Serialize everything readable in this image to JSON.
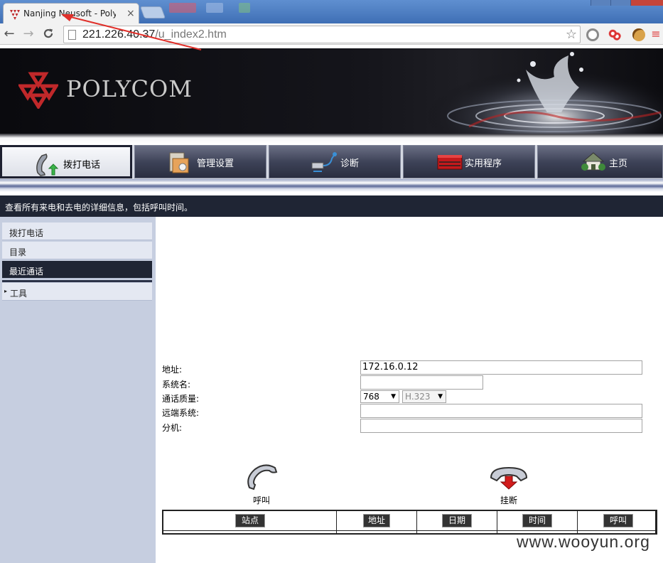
{
  "browser": {
    "tab_title": "Nanjing Neusoft - Polyc",
    "tab_close": "×",
    "url_host": "221.226.40.37",
    "url_path": "/u_index2.htm",
    "back": "←",
    "forward": "→",
    "reload": "C",
    "star": "☆"
  },
  "banner": {
    "logo_text": "POLYCOM"
  },
  "main_nav": [
    {
      "label": "拨打电话",
      "icon": "phone-icon",
      "active": true
    },
    {
      "label": "管理设置",
      "icon": "admin-settings-icon",
      "active": false
    },
    {
      "label": "诊断",
      "icon": "diagnostics-icon",
      "active": false
    },
    {
      "label": "实用程序",
      "icon": "utilities-icon",
      "active": false
    },
    {
      "label": "主页",
      "icon": "home-icon",
      "active": false
    }
  ],
  "description": "查看所有来电和去电的详细信息，包括呼叫时间。",
  "sidebar": {
    "items": [
      {
        "label": "拨打电话"
      },
      {
        "label": "目录"
      },
      {
        "label": "最近通话",
        "active": true
      },
      {
        "label": "工具",
        "arrow": "▸"
      }
    ]
  },
  "form": {
    "address_label": "地址:",
    "address_value": "172.16.0.12",
    "system_name_label": "系统名:",
    "system_name_value": "",
    "quality_label": "通话质量:",
    "quality_rate": "768",
    "quality_protocol": "H.323",
    "remote_system_label": "远端系统:",
    "remote_system_value": "",
    "extension_label": "分机:",
    "extension_value": ""
  },
  "actions": {
    "call_label": "呼叫",
    "hangup_label": "挂断"
  },
  "call_log": {
    "columns": [
      "站点",
      "地址",
      "日期",
      "时间",
      "呼叫"
    ]
  },
  "watermark": "www.wooyun.org",
  "colors": {
    "nav_dark": "#1f2534",
    "sidebar_bg": "#c6cee0",
    "annotation_red": "#e0302a",
    "hangup_red": "#d21c1c"
  }
}
